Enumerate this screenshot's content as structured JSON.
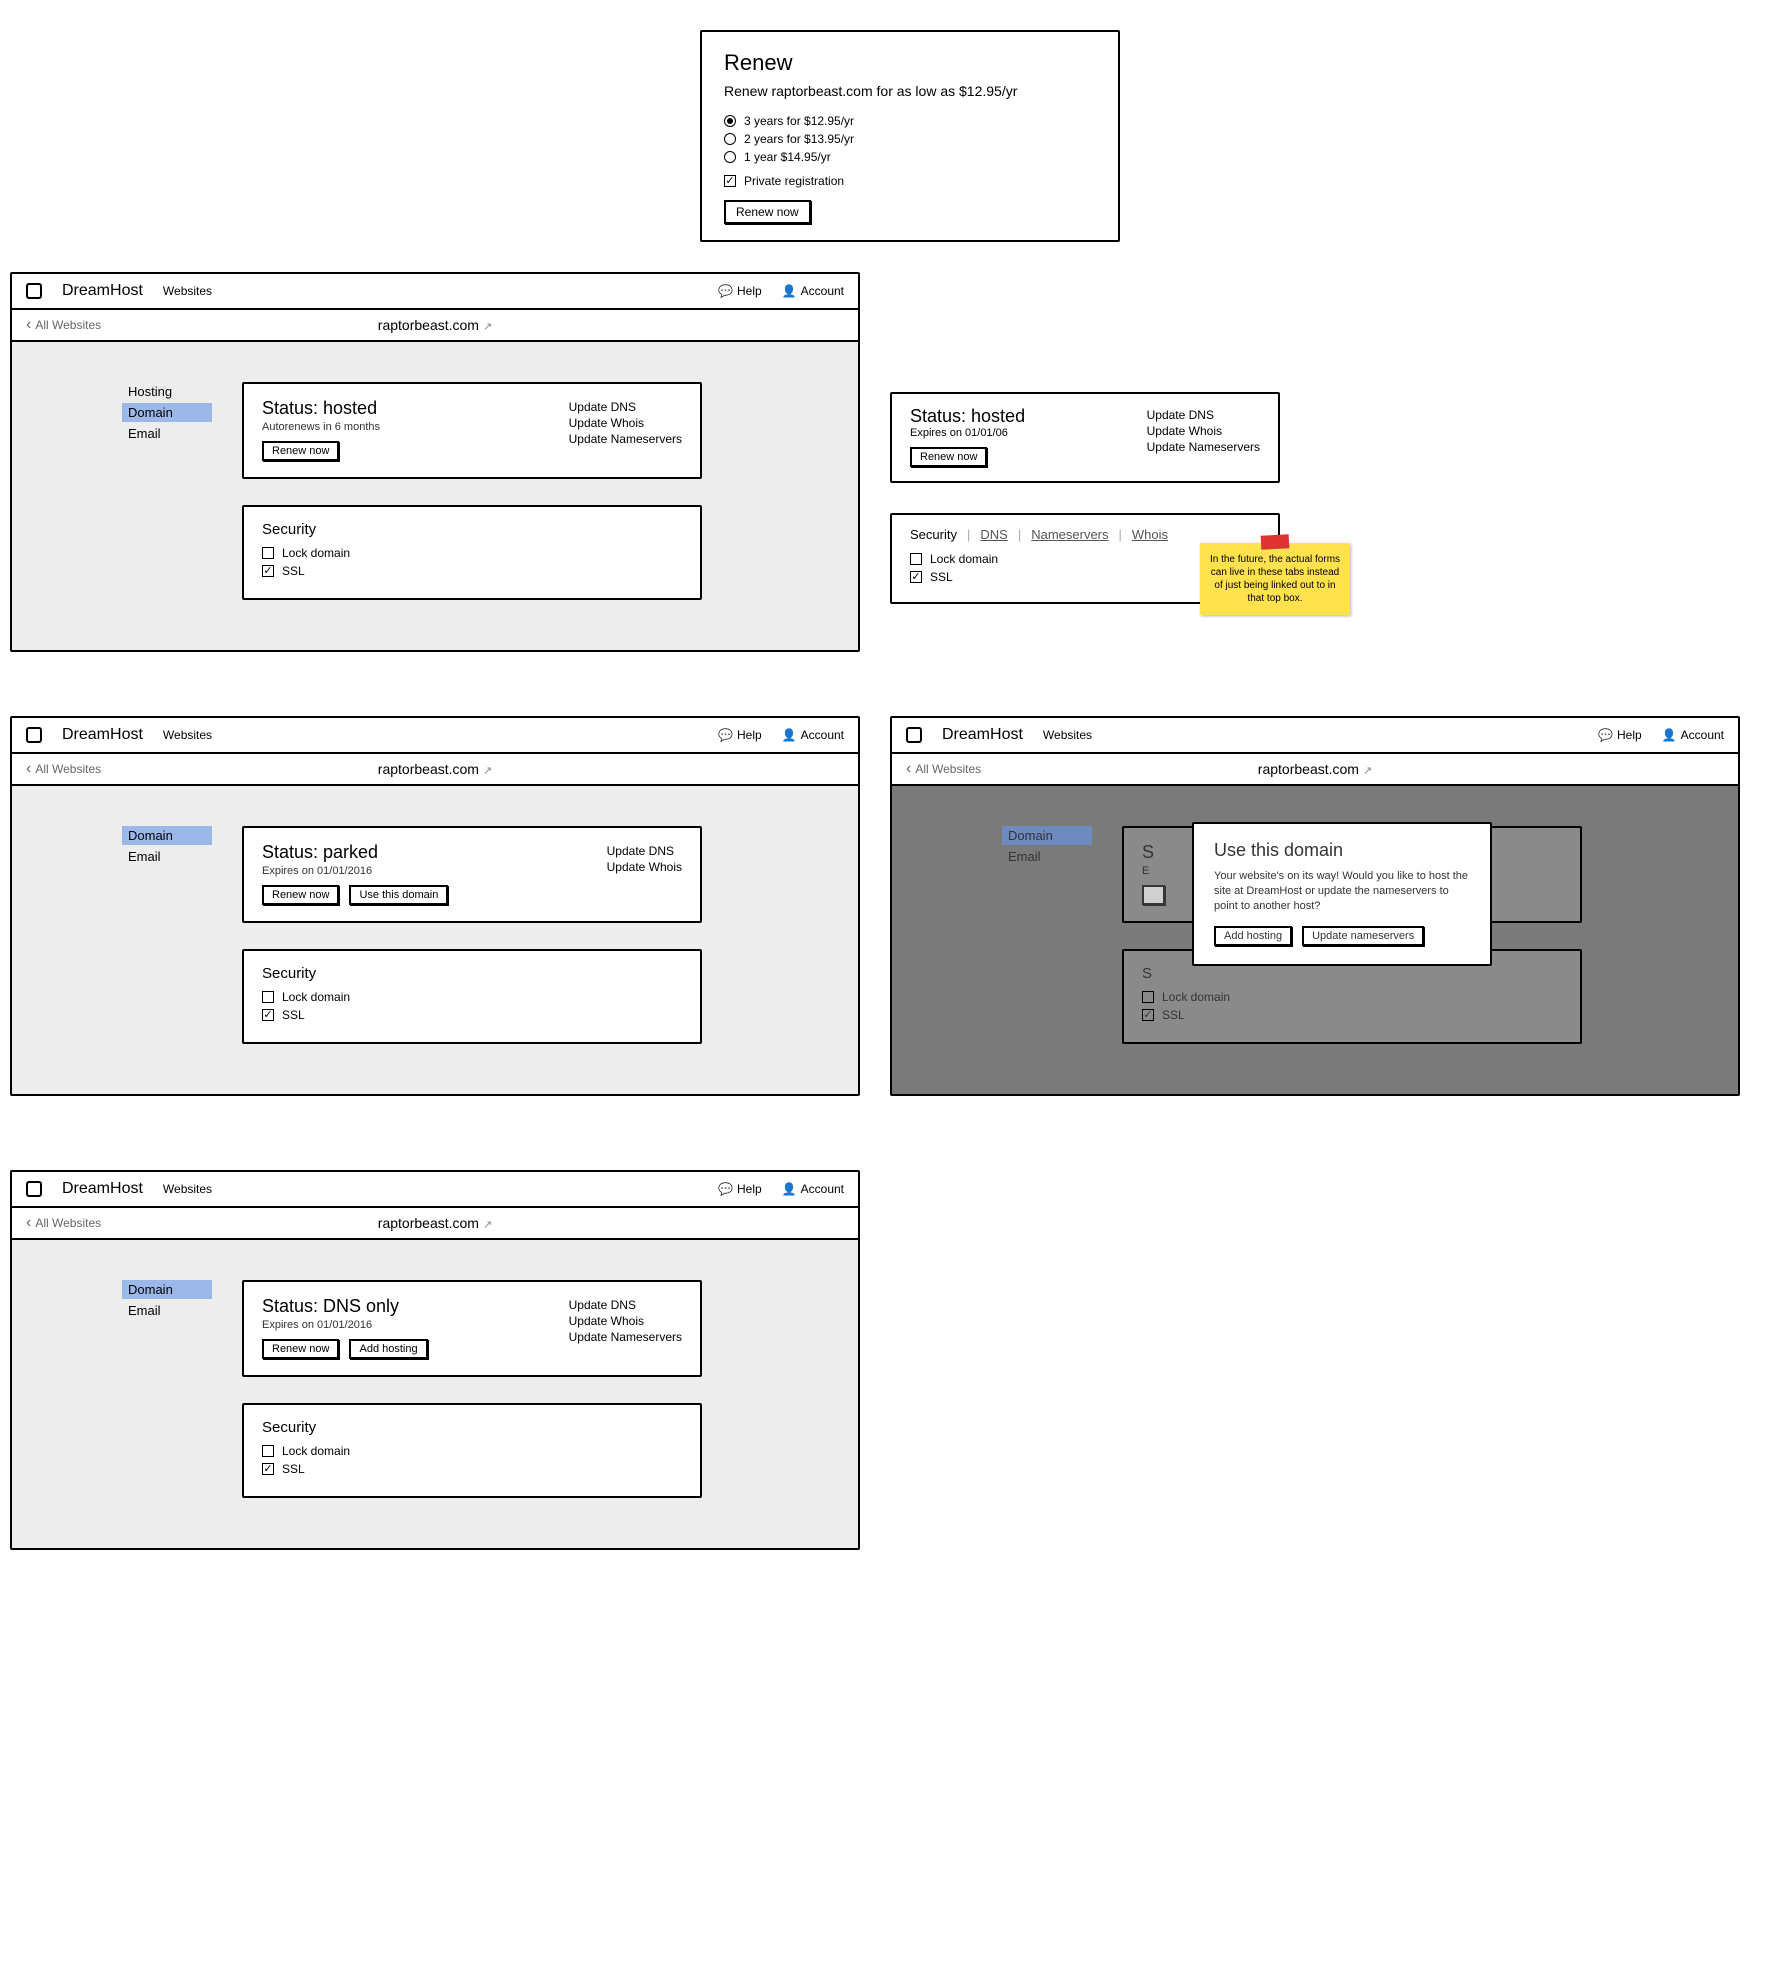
{
  "renew": {
    "title": "Renew",
    "subtitle": "Renew raptorbeast.com for as low as $12.95/yr",
    "options": [
      {
        "label": "3 years for $12.95/yr",
        "selected": true
      },
      {
        "label": "2 years for $13.95/yr",
        "selected": false
      },
      {
        "label": "1 year $14.95/yr",
        "selected": false
      }
    ],
    "private_label": "Private registration",
    "button": "Renew now"
  },
  "common": {
    "brand": "DreamHost",
    "nav_websites": "Websites",
    "help": "Help",
    "account": "Account",
    "breadcrumb": "All Websites",
    "domain_title": "raptorbeast.com",
    "side": {
      "hosting": "Hosting",
      "domain": "Domain",
      "email": "Email"
    },
    "security_title": "Security",
    "lock_domain": "Lock domain",
    "ssl": "SSL",
    "update_dns": "Update DNS",
    "update_whois": "Update Whois",
    "update_ns": "Update Nameservers",
    "renew_now": "Renew now"
  },
  "screen_hosted": {
    "status_title": "Status: hosted",
    "meta": "Autorenews in 6 months"
  },
  "float_status": {
    "status_title": "Status: hosted",
    "meta": "Expires on 01/01/06"
  },
  "float_security": {
    "tab_security": "Security",
    "tab_dns": "DNS",
    "tab_ns": "Nameservers",
    "tab_whois": "Whois"
  },
  "sticky_note": "In the future, the actual forms can live in these tabs instead of just being linked out to in that top box.",
  "screen_parked": {
    "status_title": "Status: parked",
    "meta": "Expires on 01/01/2016",
    "use_btn": "Use this domain"
  },
  "screen_modal": {
    "title": "Use this domain",
    "body": "Your website's on its way! Would you like to host the site at DreamHost or update the nameservers to point to another host?",
    "btn_add": "Add hosting",
    "btn_ns": "Update nameservers",
    "bg_status": "S",
    "bg_meta": "E",
    "bg_sec": "S"
  },
  "screen_dns": {
    "status_title": "Status: DNS only",
    "meta": "Expires on 01/01/2016",
    "add_hosting": "Add hosting"
  }
}
